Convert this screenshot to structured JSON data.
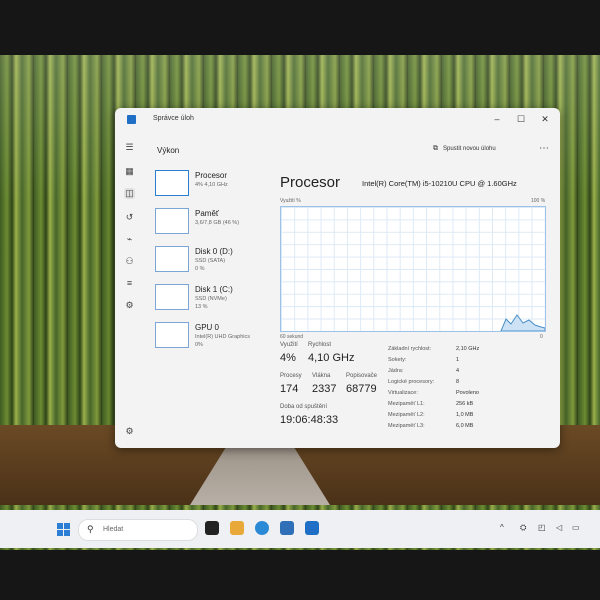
{
  "window": {
    "title": "Správce úloh",
    "page_title": "Výkon",
    "run_task_label": "Spustit novou úlohu"
  },
  "devices": [
    {
      "name": "Procesor",
      "sub": "4% 4,10 GHz"
    },
    {
      "name": "Paměť",
      "sub": "3,6/7,8 GB (46 %)"
    },
    {
      "name": "Disk 0 (D:)",
      "sub": "SSD (SATA)\n0 %"
    },
    {
      "name": "Disk 1 (C:)",
      "sub": "SSD (NVMe)\n13 %"
    },
    {
      "name": "GPU 0",
      "sub": "Intel(R) UHD Graphics\n0%"
    }
  ],
  "main": {
    "title": "Procesor",
    "cpu_model": "Intel(R) Core(TM) i5-10210U CPU @ 1.60GHz",
    "graph_util_label": "Využití %",
    "graph_max_label": "100 %",
    "graph_time_label": "60 sekund",
    "graph_min_label": "0",
    "utilization_label": "Využití",
    "utilization": "4%",
    "speed_label": "Rychlost",
    "speed": "4,10 GHz",
    "processes_label": "Procesy",
    "processes": "174",
    "threads_label": "Vlákna",
    "threads": "2337",
    "handles_label": "Popisovače",
    "handles": "68779",
    "uptime_label": "Doba od spuštění",
    "uptime": "19:06:48:33"
  },
  "specs": [
    {
      "k": "Základní rychlost:",
      "v": "2,10 GHz"
    },
    {
      "k": "Sokety:",
      "v": "1"
    },
    {
      "k": "Jádra:",
      "v": "4"
    },
    {
      "k": "Logické procesory:",
      "v": "8"
    },
    {
      "k": "Virtualizace:",
      "v": "Povoleno"
    },
    {
      "k": "Mezipaměť L1:",
      "v": "256 kB"
    },
    {
      "k": "Mezipaměť L2:",
      "v": "1,0 MB"
    },
    {
      "k": "Mezipaměť L3:",
      "v": "6,0 MB"
    }
  ],
  "taskbar": {
    "search_placeholder": "Hledat"
  },
  "colors": {
    "accent": "#2b7fd0",
    "graph_line": "#4a90c8"
  }
}
